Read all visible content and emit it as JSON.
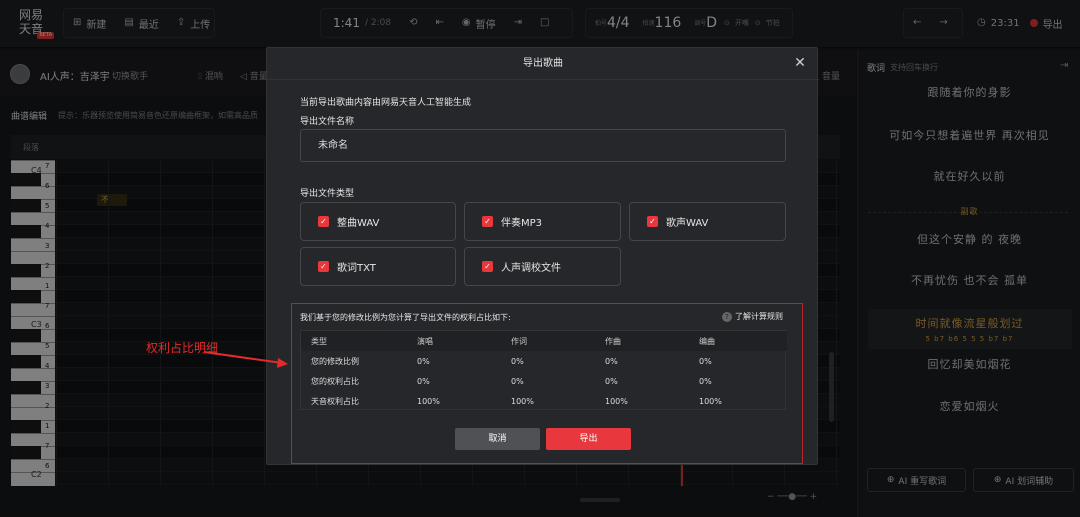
{
  "app": {
    "logo_line1": "网易",
    "logo_line2": "天音",
    "logo_badge": "BETA"
  },
  "toolbar": {
    "new_label": "新建",
    "recent_label": "最近",
    "upload_label": "上传",
    "time_current": "1:41",
    "time_total": "/ 2:08",
    "pause_label": "暂停",
    "beat_label": "拍号",
    "beat_value": "4/4",
    "tempo_label": "拍速",
    "tempo_value": "116",
    "key_label": "调号",
    "key_value": "D",
    "count_in_label": "开嘴",
    "metronome_label": "节拍",
    "clock": "23:31",
    "export_label": "导出"
  },
  "row2": {
    "ai_voice_label": "AI人声：吉泽宇",
    "switch_singer": "切换歌手",
    "mix_label": "混响",
    "volume_label": "音量",
    "volume_label_right": "音量"
  },
  "editor": {
    "title": "曲谱编辑",
    "hint": "提示：乐器预览使用简易音色还原编曲框架，如需高品质",
    "segment_label": "段落",
    "note_text": "不",
    "octave_labels": [
      "C4",
      "C3",
      "C2"
    ],
    "key_numbers": [
      "7",
      "6",
      "5",
      "4",
      "3",
      "2",
      "1",
      "7",
      "6",
      "5",
      "4",
      "3",
      "2",
      "1",
      "7",
      "6"
    ]
  },
  "lyrics_panel": {
    "title": "歌词",
    "subtitle": "支持回车换行",
    "lines": [
      "跟随着你的身影",
      "可如今只想着遍世界 再次相见",
      "就在好久以前",
      "但这个安静  的 夜晚",
      "不再忧伤 也不会 孤单",
      "时间就像流星般划过",
      "回忆却美如烟花",
      "恋爱如烟火"
    ],
    "section_label": "副歌",
    "highlight_numbers": "5 b7 b6 5 5 5 b7 b7",
    "ai_rewrite_label": "AI 重写歌词",
    "ai_assist_label": "AI 划词辅助"
  },
  "modal": {
    "title": "导出歌曲",
    "notice": "当前导出歌曲内容由网易天音人工智能生成",
    "filename_label": "导出文件名称",
    "filename_value": "未命名",
    "filetype_label": "导出文件类型",
    "file_types": [
      "整曲WAV",
      "伴奏MP3",
      "歌声WAV",
      "歌词TXT",
      "人声调校文件"
    ],
    "rights_title": "我们基于您的修改比例为您计算了导出文件的权利占比如下:",
    "rules_link": "了解计算规则",
    "table": {
      "headers": [
        "类型",
        "演唱",
        "作词",
        "作曲",
        "编曲"
      ],
      "rows": [
        [
          "您的修改比例",
          "0%",
          "0%",
          "0%",
          "0%"
        ],
        [
          "您的权利占比",
          "0%",
          "0%",
          "0%",
          "0%"
        ],
        [
          "天音权利占比",
          "100%",
          "100%",
          "100%",
          "100%"
        ]
      ]
    },
    "cancel_label": "取消",
    "confirm_label": "导出"
  },
  "annotation": {
    "text": "权利占比明细"
  },
  "colors": {
    "accent_red": "#e8383d",
    "annotation_red": "#e32b2b",
    "lyric_highlight": "#d9a441"
  }
}
